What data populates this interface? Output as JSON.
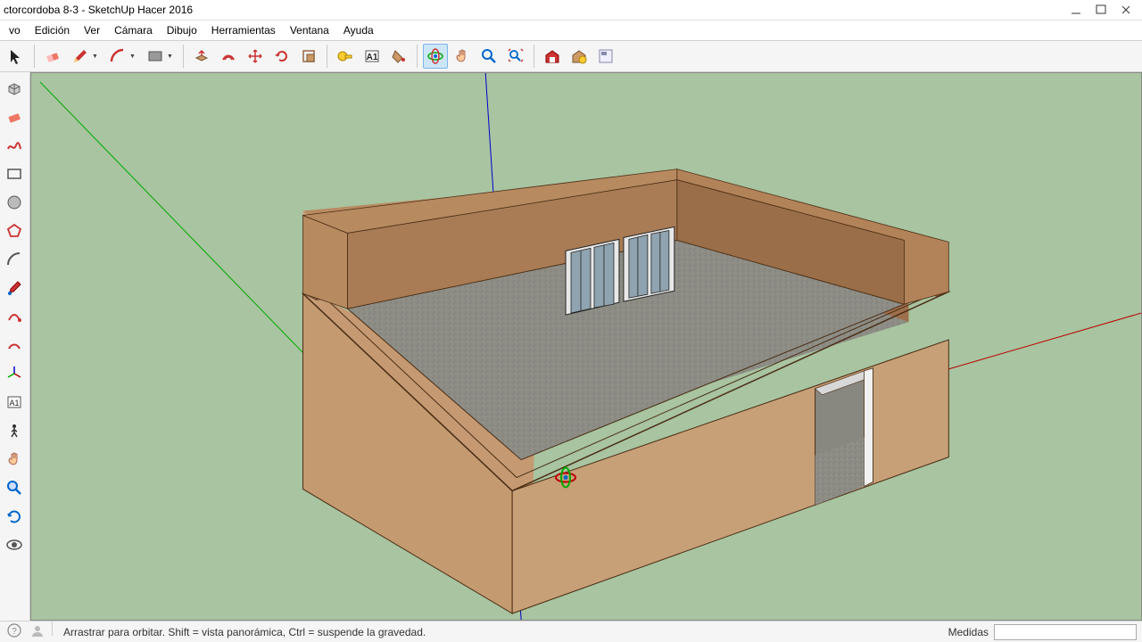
{
  "window": {
    "title": "ctorcordoba 8-3 - SketchUp Hacer 2016"
  },
  "menu": {
    "items": [
      "vo",
      "Edición",
      "Ver",
      "Cámara",
      "Dibujo",
      "Herramientas",
      "Ventana",
      "Ayuda"
    ]
  },
  "toolbar_top": [
    {
      "name": "select-tool",
      "icon": "cursor"
    },
    {
      "sep": true
    },
    {
      "name": "eraser-tool",
      "icon": "eraser"
    },
    {
      "name": "line-tool",
      "icon": "pencil",
      "dropdown": true
    },
    {
      "name": "arc-tool",
      "icon": "arc",
      "dropdown": true
    },
    {
      "name": "shape-tool",
      "icon": "rect",
      "dropdown": true
    },
    {
      "sep": true
    },
    {
      "name": "pushpull-tool",
      "icon": "pushpull"
    },
    {
      "name": "offset-tool",
      "icon": "offset"
    },
    {
      "name": "move-tool",
      "icon": "move"
    },
    {
      "name": "rotate-tool",
      "icon": "rotate"
    },
    {
      "name": "scale-tool",
      "icon": "scale"
    },
    {
      "sep": true
    },
    {
      "name": "tape-tool",
      "icon": "tape"
    },
    {
      "name": "text-tool",
      "icon": "textA"
    },
    {
      "name": "paint-tool",
      "icon": "bucket"
    },
    {
      "sep": true
    },
    {
      "name": "orbit-tool",
      "icon": "orbit",
      "active": true
    },
    {
      "name": "pan-tool",
      "icon": "hand"
    },
    {
      "name": "zoom-tool",
      "icon": "zoom"
    },
    {
      "name": "zoom-extents-tool",
      "icon": "zoom-ext"
    },
    {
      "sep": true
    },
    {
      "name": "warehouse-tool",
      "icon": "warehouse"
    },
    {
      "name": "ext-warehouse-tool",
      "icon": "ext-warehouse"
    },
    {
      "name": "layout-tool",
      "icon": "layout"
    }
  ],
  "toolbar_left": [
    {
      "name": "component-tool",
      "icon": "component"
    },
    {
      "name": "eraser2-tool",
      "icon": "eraser2"
    },
    {
      "name": "freehand-tool",
      "icon": "freehand"
    },
    {
      "name": "rectangle-tool",
      "icon": "rect2"
    },
    {
      "name": "circle-tool",
      "icon": "circle"
    },
    {
      "name": "polygon-tool",
      "icon": "polygon"
    },
    {
      "name": "arc2-tool",
      "icon": "arc2"
    },
    {
      "name": "paint2-tool",
      "icon": "dropper"
    },
    {
      "name": "followme-tool",
      "icon": "followme"
    },
    {
      "name": "offset2-tool",
      "icon": "offset2"
    },
    {
      "name": "axes-tool",
      "icon": "axes"
    },
    {
      "name": "dim-tool",
      "icon": "textA2"
    },
    {
      "name": "walk-tool",
      "icon": "walk"
    },
    {
      "name": "pan2-tool",
      "icon": "hand2"
    },
    {
      "name": "zoom2-tool",
      "icon": "zoom2"
    },
    {
      "name": "prev-tool",
      "icon": "prev"
    },
    {
      "name": "look-tool",
      "icon": "eye"
    }
  ],
  "status": {
    "hint": "Arrastrar para orbitar. Shift = vista panorámica, Ctrl = suspende la gravedad.",
    "measure_label": "Medidas"
  }
}
